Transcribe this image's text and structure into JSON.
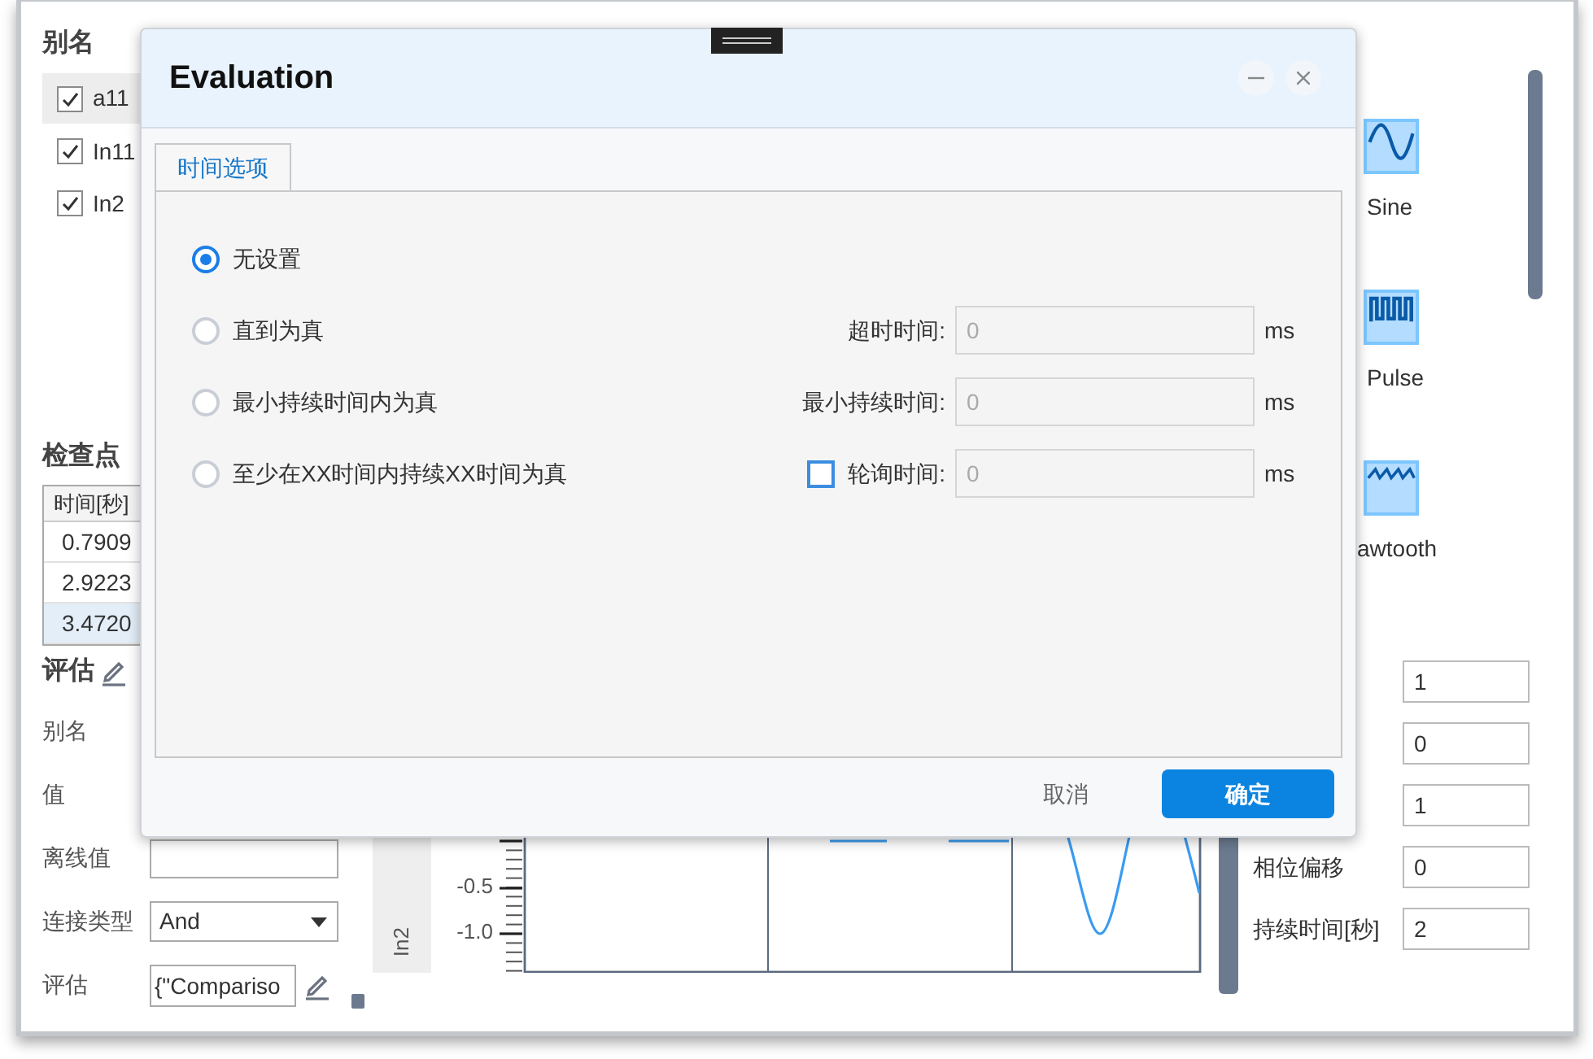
{
  "window": {
    "alias_heading": "别名",
    "aliases": [
      {
        "label": "a11",
        "checked": true,
        "selected": true
      },
      {
        "label": "In11",
        "checked": true,
        "selected": false
      },
      {
        "label": "In2",
        "checked": true,
        "selected": false
      }
    ],
    "checkpoints": {
      "title": "检查点",
      "column": "时间[秒]",
      "rows": [
        {
          "value": "0.7909",
          "selected": false
        },
        {
          "value": "2.9223",
          "selected": false
        },
        {
          "value": "3.4720",
          "selected": true
        }
      ]
    },
    "evaluation": {
      "title": "评估",
      "fields": [
        {
          "kind": "label",
          "label": "别名"
        },
        {
          "kind": "label",
          "label": "值"
        },
        {
          "kind": "input",
          "label": "离线值"
        },
        {
          "kind": "select",
          "label": "连接类型",
          "value": "And"
        },
        {
          "kind": "editable",
          "label": "评估",
          "value": "{\"Compariso"
        }
      ]
    },
    "chart": {
      "channel": "In2",
      "yticks": [
        "-0.5",
        "-1.0"
      ]
    },
    "waveforms": [
      {
        "kind": "sine",
        "label": "Sine"
      },
      {
        "kind": "pulse",
        "label": "Pulse"
      },
      {
        "kind": "sawtooth",
        "label": "awtooth"
      }
    ],
    "params": [
      {
        "value": "1"
      },
      {
        "value": "0"
      },
      {
        "value": "1"
      },
      {
        "label": "相位偏移",
        "value": "0"
      },
      {
        "label": "持续时间[秒]",
        "value": "2"
      }
    ]
  },
  "dialog": {
    "title": "Evaluation",
    "tabs": [
      {
        "label": "时间选项",
        "selected": true
      }
    ],
    "options": [
      {
        "label": "无设置",
        "selected": true
      },
      {
        "label": "直到为真",
        "selected": false,
        "field": {
          "label": "超时时间:",
          "placeholder": "0",
          "unit": "ms"
        }
      },
      {
        "label": "最小持续时间内为真",
        "selected": false,
        "field": {
          "label": "最小持续时间:",
          "placeholder": "0",
          "unit": "ms"
        }
      },
      {
        "label": "至少在XX时间内持续XX时间为真",
        "selected": false,
        "field": {
          "label": "轮询时间:",
          "placeholder": "0",
          "unit": "ms",
          "checked": false
        }
      }
    ],
    "cancel": "取消",
    "ok": "确定"
  }
}
